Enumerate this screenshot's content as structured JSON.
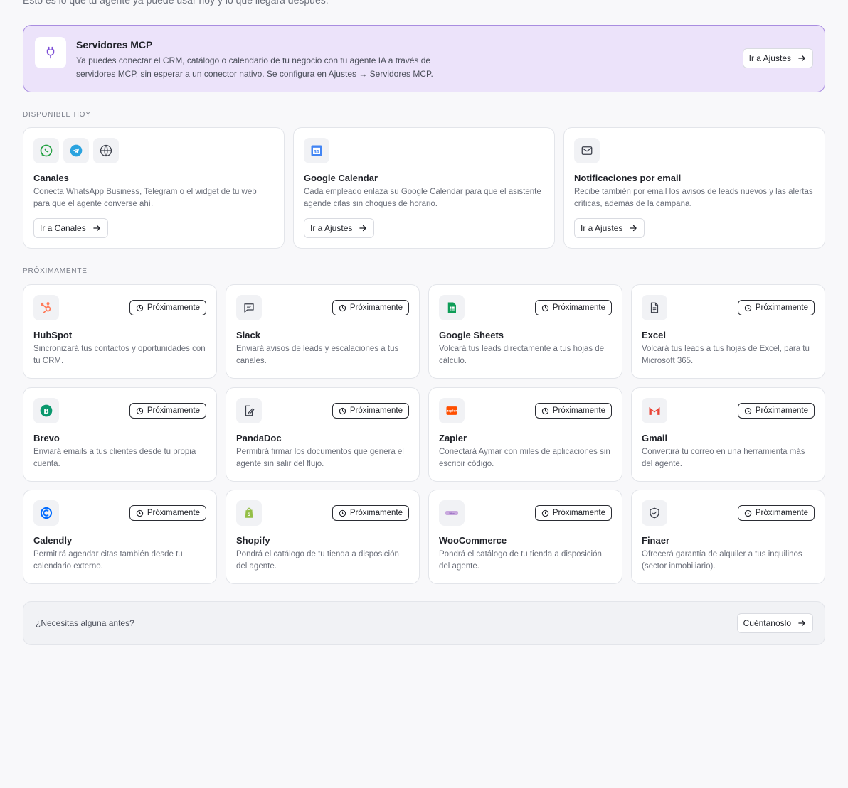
{
  "intro": "Esto es lo que tu agente ya puede usar hoy y lo que llegará después.",
  "mcp": {
    "title": "Servidores MCP",
    "description": "Ya puedes conectar el CRM, catálogo o calendario de tu negocio con tu agente IA a través de servidores MCP, sin esperar a un conector nativo. Se configura en Ajustes → Servidores MCP.",
    "button": "Ir a Ajustes"
  },
  "available_label": "DISPONIBLE HOY",
  "available": [
    {
      "icons": [
        "whatsapp-icon",
        "telegram-icon",
        "globe-icon"
      ],
      "title": "Canales",
      "description": "Conecta WhatsApp Business, Telegram o el widget de tu web para que el agente converse ahí.",
      "button": "Ir a Canales"
    },
    {
      "icons": [
        "google-calendar-icon"
      ],
      "title": "Google Calendar",
      "description": "Cada empleado enlaza su Google Calendar para que el asistente agende citas sin choques de horario.",
      "button": "Ir a Ajustes"
    },
    {
      "icons": [
        "mail-icon"
      ],
      "title": "Notificaciones por email",
      "description": "Recibe también por email los avisos de leads nuevos y las alertas críticas, además de la campana.",
      "button": "Ir a Ajustes"
    }
  ],
  "soon_label": "PRÓXIMAMENTE",
  "badge": "Próximamente",
  "soon": [
    {
      "icon": "hubspot-icon",
      "title": "HubSpot",
      "description": "Sincronizará tus contactos y oportunidades con tu CRM."
    },
    {
      "icon": "chat-icon",
      "title": "Slack",
      "description": "Enviará avisos de leads y escalaciones a tus canales."
    },
    {
      "icon": "google-sheets-icon",
      "title": "Google Sheets",
      "description": "Volcará tus leads directamente a tus hojas de cálculo."
    },
    {
      "icon": "document-icon",
      "title": "Excel",
      "description": "Volcará tus leads a tus hojas de Excel, para tu Microsoft 365."
    },
    {
      "icon": "brevo-icon",
      "title": "Brevo",
      "description": "Enviará emails a tus clientes desde tu propia cuenta."
    },
    {
      "icon": "signature-icon",
      "title": "PandaDoc",
      "description": "Permitirá firmar los documentos que genera el agente sin salir del flujo."
    },
    {
      "icon": "zapier-icon",
      "title": "Zapier",
      "description": "Conectará Aymar con miles de aplicaciones sin escribir código."
    },
    {
      "icon": "gmail-icon",
      "title": "Gmail",
      "description": "Convertirá tu correo en una herramienta más del agente."
    },
    {
      "icon": "calendly-icon",
      "title": "Calendly",
      "description": "Permitirá agendar citas también desde tu calendario externo."
    },
    {
      "icon": "shopify-icon",
      "title": "Shopify",
      "description": "Pondrá el catálogo de tu tienda a disposición del agente."
    },
    {
      "icon": "woocommerce-icon",
      "title": "WooCommerce",
      "description": "Pondrá el catálogo de tu tienda a disposición del agente."
    },
    {
      "icon": "shield-icon",
      "title": "Finaer",
      "description": "Ofrecerá garantía de alquiler a tus inquilinos (sector inmobiliario)."
    }
  ],
  "footer": {
    "text": "¿Necesitas alguna antes?",
    "button": "Cuéntanoslo"
  },
  "colors": {
    "mcp_bg": "#ece3fa",
    "mcp_border": "#a98de0",
    "accent_purple": "#7c4dd6"
  }
}
